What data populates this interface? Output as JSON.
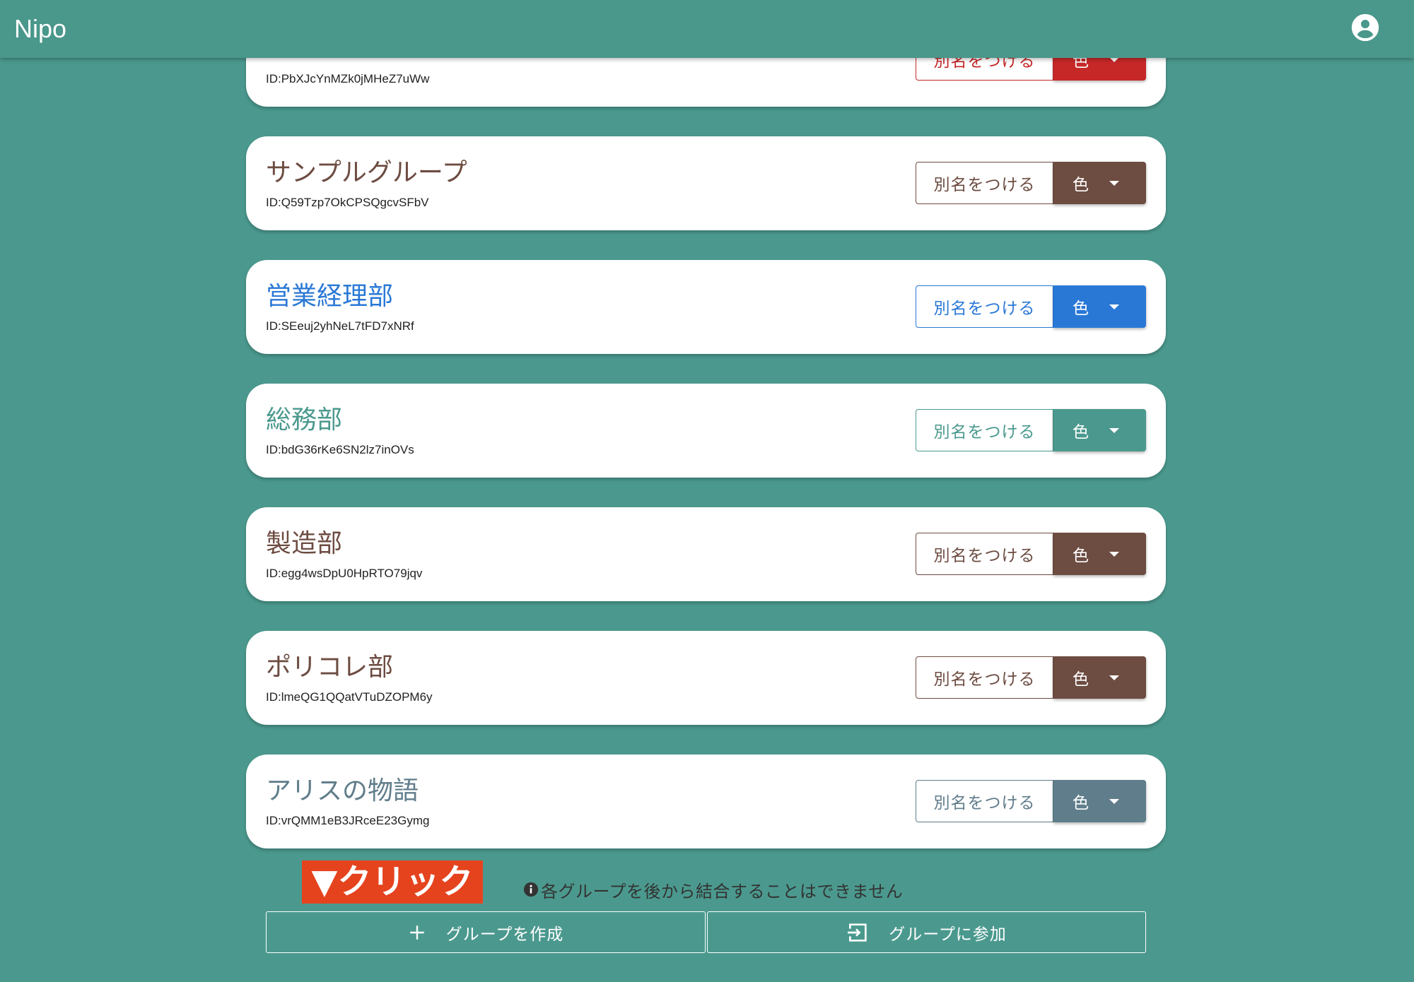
{
  "app": {
    "title": "Nipo"
  },
  "header": {
    "account_icon": "account-circle-icon"
  },
  "group_actions": {
    "alias_label": "別名をつける",
    "color_label": "色"
  },
  "groups": [
    {
      "name": "",
      "id": "ID:PbXJcYnMZk0jMHeZ7uWw",
      "color": "#c62828"
    },
    {
      "name": "サンプルグループ",
      "id": "ID:Q59Tzp7OkCPSQgcvSFbV",
      "color": "#6d4c41"
    },
    {
      "name": "営業経理部",
      "id": "ID:SEeuj2yhNeL7tFD7xNRf",
      "color": "#2a78d6"
    },
    {
      "name": "総務部",
      "id": "ID:bdG36rKe6SN2lz7inOVs",
      "color": "#4b998e"
    },
    {
      "name": "製造部",
      "id": "ID:egg4wsDpU0HpRTO79jqv",
      "color": "#6d4c41"
    },
    {
      "name": "ポリコレ部",
      "id": "ID:lmeQG1QQatVTuDZOPM6y",
      "color": "#6d4c41"
    },
    {
      "name": "アリスの物語",
      "id": "ID:vrQMM1eB3JRceE23Gymg",
      "color": "#607d8b"
    }
  ],
  "annotation": {
    "label": "▼クリック",
    "background": "#e5431e"
  },
  "notice": {
    "icon": "info-icon",
    "text": "各グループを後から結合することはできません"
  },
  "actions": {
    "create_icon": "plus-icon",
    "create_label": "グループを作成",
    "join_icon": "login-icon",
    "join_label": "グループに参加"
  },
  "colors": {
    "background": "#4b998e",
    "header": "#4a978b",
    "card": "#ffffff"
  }
}
